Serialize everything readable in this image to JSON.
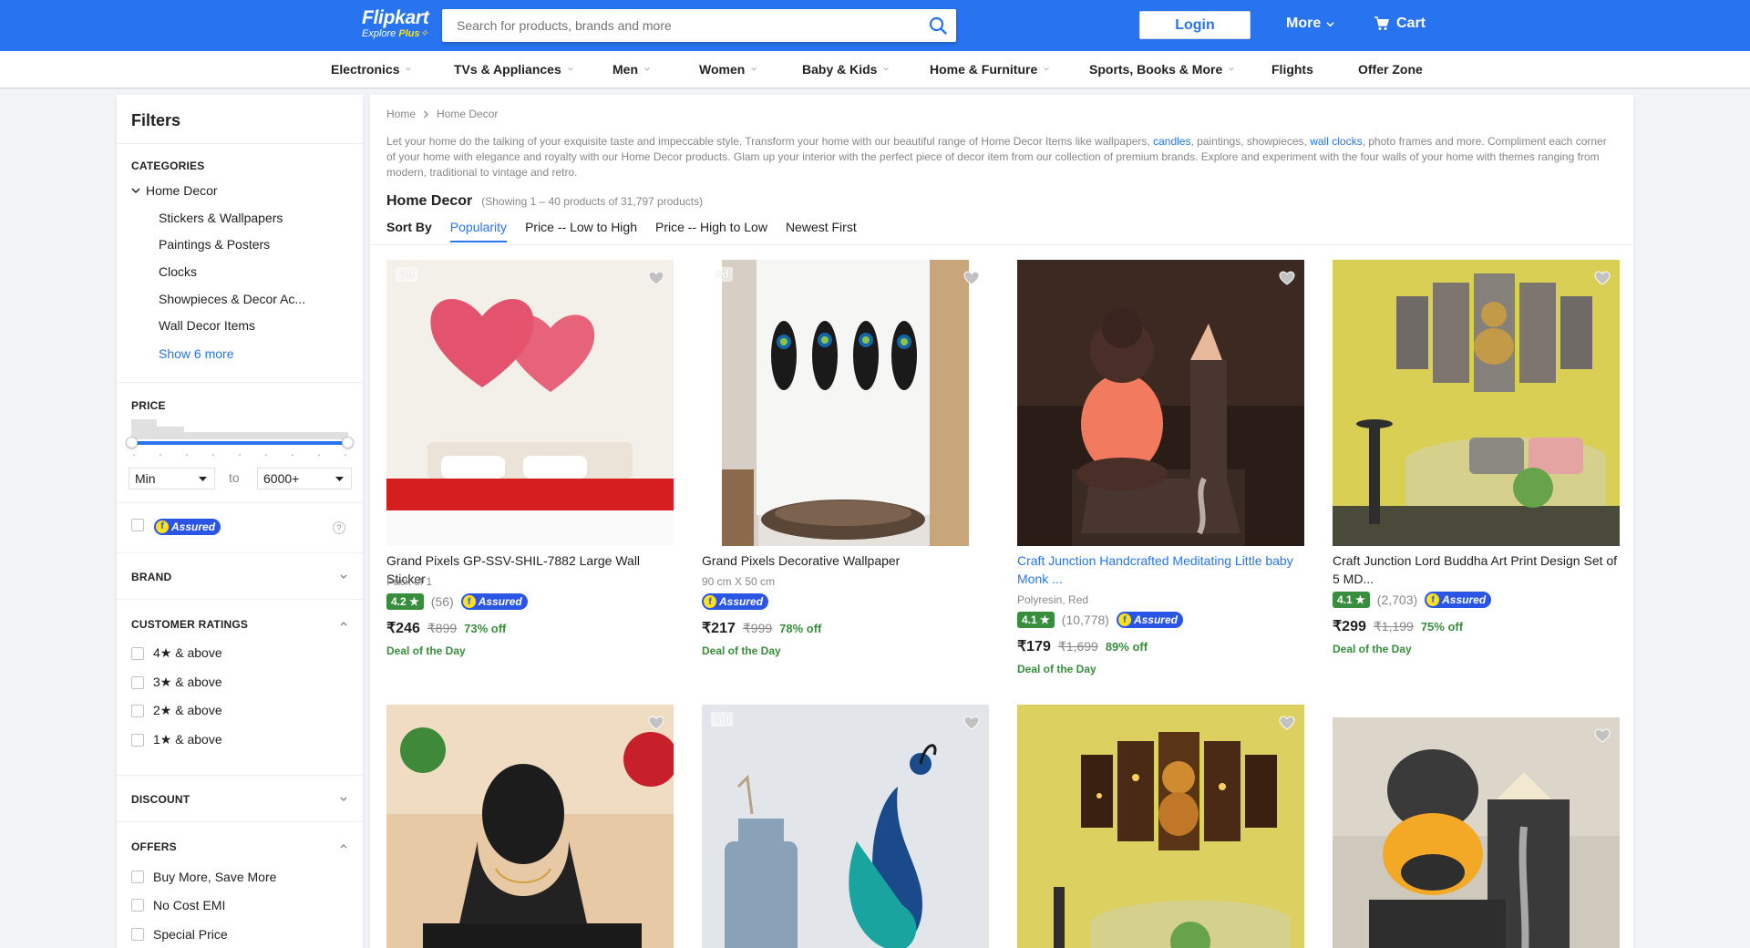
{
  "header": {
    "logo": "Flipkart",
    "logo_sub": "Explore",
    "logo_plus": "Plus",
    "search_placeholder": "Search for products, brands and more",
    "login_label": "Login",
    "more_label": "More",
    "cart_label": "Cart",
    "brand_color": "#2874f0"
  },
  "nav": [
    "Electronics",
    "TVs & Appliances",
    "Men",
    "Women",
    "Baby & Kids",
    "Home & Furniture",
    "Sports, Books & More",
    "Flights",
    "Offer Zone"
  ],
  "filters": {
    "title": "Filters",
    "categories_heading": "CATEGORIES",
    "root_category": "Home Decor",
    "subcategories": [
      "Stickers & Wallpapers",
      "Paintings & Posters",
      "Clocks",
      "Showpieces & Decor Ac...",
      "Wall Decor Items"
    ],
    "show_more": "Show 6 more",
    "price_heading": "PRICE",
    "price_min": "Min",
    "price_to": "to",
    "price_max": "6000+",
    "assured_label": "Assured",
    "help": "?",
    "brand_heading": "BRAND",
    "ratings_heading": "CUSTOMER RATINGS",
    "ratings": [
      "4★ & above",
      "3★ & above",
      "2★ & above",
      "1★ & above"
    ],
    "discount_heading": "DISCOUNT",
    "offers_heading": "OFFERS",
    "offers": [
      "Buy More, Save More",
      "No Cost EMI",
      "Special Price"
    ]
  },
  "main": {
    "breadcrumb": [
      "Home",
      "Home Decor"
    ],
    "description_parts": {
      "p1": "Let your home do the talking of your exquisite taste and impeccable style. Transform your home with our beautiful range of Home Decor Items like wallpapers, ",
      "link1": "candles",
      "p2": ", paintings, showpieces, ",
      "link2": "wall clocks",
      "p3": ", photo frames and more. Compliment each corner of your home with elegance and royalty with our Home Decor products. Glam up your interior with the perfect piece of decor item from our collection of premium brands. Explore and experiment with the four walls of your home with themes ranging from modern, traditional to vintage and retro."
    },
    "title": "Home Decor",
    "count": "(Showing 1 – 40 products of 31,797 products)",
    "sort_label": "Sort By",
    "sort_options": [
      "Popularity",
      "Price -- Low to High",
      "Price -- High to Low",
      "Newest First"
    ]
  },
  "products": [
    {
      "title": "Grand Pixels GP-SSV-SHIL-7882 Large Wall Sticker",
      "sub": "Pack of 1",
      "rating": "4.2 ★",
      "reviews": "(56)",
      "price": "₹246",
      "mrp": "₹899",
      "off": "73% off",
      "deal": "Deal of the Day",
      "ad": "Ad"
    },
    {
      "title": "Grand Pixels Decorative Wallpaper",
      "sub": "90 cm X 50 cm",
      "price": "₹217",
      "mrp": "₹999",
      "off": "78% off",
      "deal": "Deal of the Day",
      "ad": "Ad"
    },
    {
      "title": "Craft Junction Handcrafted Meditating Little baby Monk ...",
      "sub": "Polyresin, Red",
      "rating": "4.1 ★",
      "reviews": "(10,778)",
      "price": "₹179",
      "mrp": "₹1,699",
      "off": "89% off",
      "deal": "Deal of the Day"
    },
    {
      "title": "Craft Junction Lord Buddha Art Print Design Set of 5 MD...",
      "rating": "4.1 ★",
      "reviews": "(2,703)",
      "price": "₹299",
      "mrp": "₹1,199",
      "off": "75% off",
      "deal": "Deal of the Day"
    },
    {
      "ad": ""
    },
    {
      "ad": "Ad"
    },
    {
      "ad": ""
    },
    {
      "ad": ""
    }
  ]
}
